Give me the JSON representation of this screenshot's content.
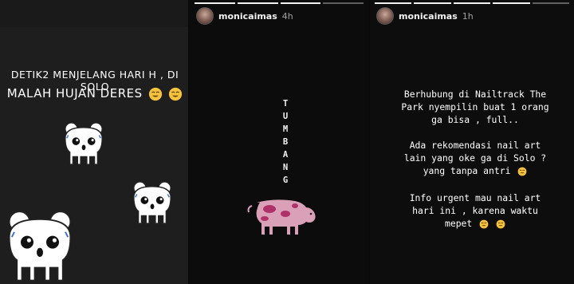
{
  "panels": {
    "left": {
      "caption_line1": "DETIK2 MENJELANG HARI H , DI SOLO",
      "caption_line2": "MALAH HUJAN DERES",
      "stickers": [
        "sad-bear-sticker",
        "sad-bear-sticker",
        "sad-bear-sticker"
      ]
    },
    "middle": {
      "username": "monicaimas",
      "time": "4h",
      "vertical_word": [
        "T",
        "U",
        "M",
        "B",
        "A",
        "N",
        "G"
      ],
      "sticker": "pink-cow-sticker"
    },
    "right": {
      "username": "monicaimas",
      "time": "1h",
      "paragraph1": [
        "Berhubung di Nailtrack The",
        "Park nyempilin buat 1 orang",
        "ga bisa , full.."
      ],
      "paragraph2": [
        "Ada rekomendasi nail art",
        "lain yang oke ga di Solo ?",
        "yang tanpa antri"
      ],
      "paragraph3": [
        "Info urgent mau nail art",
        "hari ini , karena waktu",
        "mepet"
      ]
    }
  },
  "colors": {
    "emoji_yellow": "#f5c33b",
    "cow_pink": "#d9a0b8",
    "cow_spots": "#b0306a"
  }
}
